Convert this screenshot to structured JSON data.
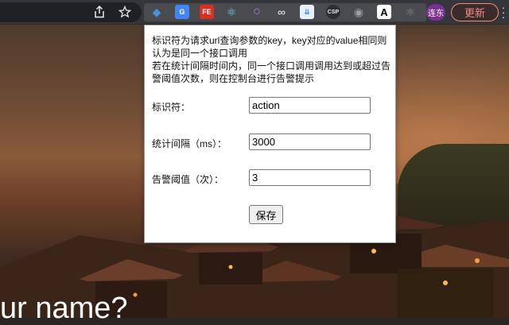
{
  "toolbar": {
    "share_icon": "share-icon",
    "bookmark_icon": "star-icon",
    "extensions": [
      {
        "name": "gem-extension",
        "label": "◆",
        "color": "#4a90d9"
      },
      {
        "name": "translate-extension",
        "label": "G",
        "color": "#4285f4"
      },
      {
        "name": "fe-extension",
        "label": "FE",
        "color": "#d93025"
      },
      {
        "name": "react-extension",
        "label": "⚛",
        "color": "#61dafb"
      },
      {
        "name": "circle-extension",
        "label": "○",
        "color": "#b57fd6"
      },
      {
        "name": "link-extension",
        "label": "∞",
        "color": "#cfcfcf"
      },
      {
        "name": "download-extension",
        "label": "⇊",
        "color": "#4285f4"
      },
      {
        "name": "csp-extension",
        "label": "CSP",
        "color": "#5f6368"
      },
      {
        "name": "camera-extension",
        "label": "◉",
        "color": "#9aa0a6"
      },
      {
        "name": "a-extension",
        "label": "A",
        "color": "#ffffff"
      },
      {
        "name": "puzzle-extension",
        "label": "✱",
        "color": "#5f6368"
      }
    ],
    "avatar_text": "连东",
    "update_label": "更新"
  },
  "popup": {
    "desc_line1": "标识符为请求url查询参数的key，key对应的value相同则认为是同一个接口调用",
    "desc_line2": "若在统计间隔时间内，同一个接口调用调用达到或超过告警阈值次数，则在控制台进行告警提示",
    "identifier_label": "标识符：",
    "identifier_value": "action",
    "interval_label": "统计间隔（ms）：",
    "interval_value": "3000",
    "threshold_label": "告警阈值（次）：",
    "threshold_value": "3",
    "save_label": "保存"
  },
  "page": {
    "heading_partial": "ur name?"
  }
}
